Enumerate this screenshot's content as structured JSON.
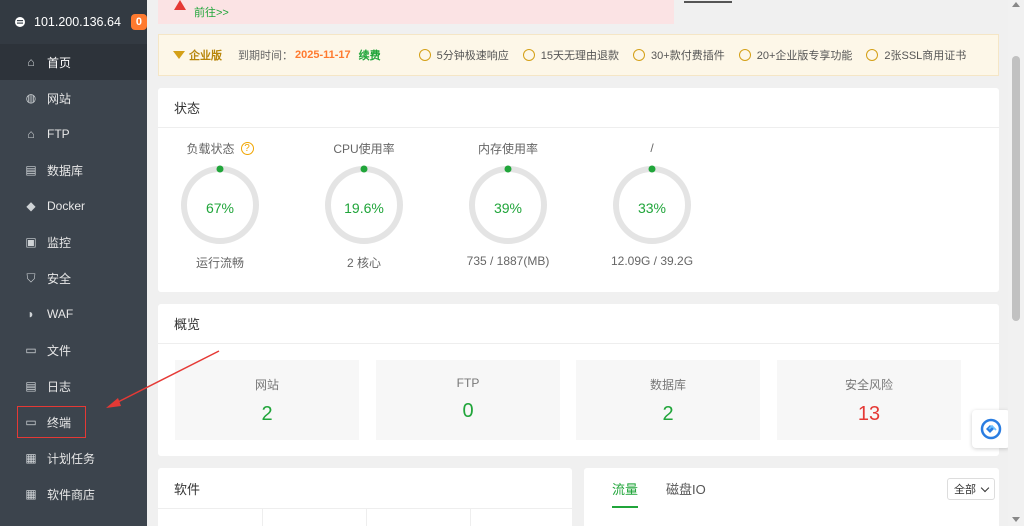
{
  "sidebar": {
    "server_ip": "101.200.136.64",
    "badge_count": "0",
    "items": [
      {
        "label": "首页",
        "icon": "home-icon",
        "active": true
      },
      {
        "label": "网站",
        "icon": "globe-icon"
      },
      {
        "label": "FTP",
        "icon": "ftp-icon"
      },
      {
        "label": "数据库",
        "icon": "database-icon"
      },
      {
        "label": "Docker",
        "icon": "docker-icon"
      },
      {
        "label": "监控",
        "icon": "monitor-icon"
      },
      {
        "label": "安全",
        "icon": "shield-icon"
      },
      {
        "label": "WAF",
        "icon": "waf-icon"
      },
      {
        "label": "文件",
        "icon": "folder-icon"
      },
      {
        "label": "日志",
        "icon": "log-icon"
      },
      {
        "label": "终端",
        "icon": "terminal-icon"
      },
      {
        "label": "计划任务",
        "icon": "calendar-icon"
      },
      {
        "label": "软件商店",
        "icon": "grid-icon"
      }
    ]
  },
  "alert": {
    "link_text": "前往>>"
  },
  "probar": {
    "edition": "企业版",
    "expire_label": "到期时间：",
    "expire_date": "2025-11-17",
    "renew": "续费",
    "features": [
      "5分钟极速响应",
      "15天无理由退款",
      "30+款付费插件",
      "20+企业版专享功能",
      "2张SSL商用证书"
    ]
  },
  "status": {
    "title": "状态",
    "gauges": [
      {
        "label": "负载状态",
        "value": "67%",
        "percent": 67,
        "sub": "运行流畅",
        "help": "?"
      },
      {
        "label": "CPU使用率",
        "value": "19.6%",
        "percent": 19.6,
        "sub": "2 核心"
      },
      {
        "label": "内存使用率",
        "value": "39%",
        "percent": 39,
        "sub": "735 / 1887(MB)"
      },
      {
        "label": "/",
        "value": "33%",
        "percent": 33,
        "sub": "12.09G / 39.2G"
      }
    ]
  },
  "overview": {
    "title": "概览",
    "boxes": [
      {
        "label": "网站",
        "value": "2"
      },
      {
        "label": "FTP",
        "value": "0"
      },
      {
        "label": "数据库",
        "value": "2"
      },
      {
        "label": "安全风险",
        "value": "13",
        "danger": true
      }
    ]
  },
  "software": {
    "title": "软件"
  },
  "traffic": {
    "tabs": [
      "流量",
      "磁盘IO"
    ],
    "select_value": "全部"
  },
  "colors": {
    "green": "#20a53a",
    "orange": "#ff7a2f",
    "red": "#e53935",
    "sidebar_bg": "#3c444d"
  }
}
